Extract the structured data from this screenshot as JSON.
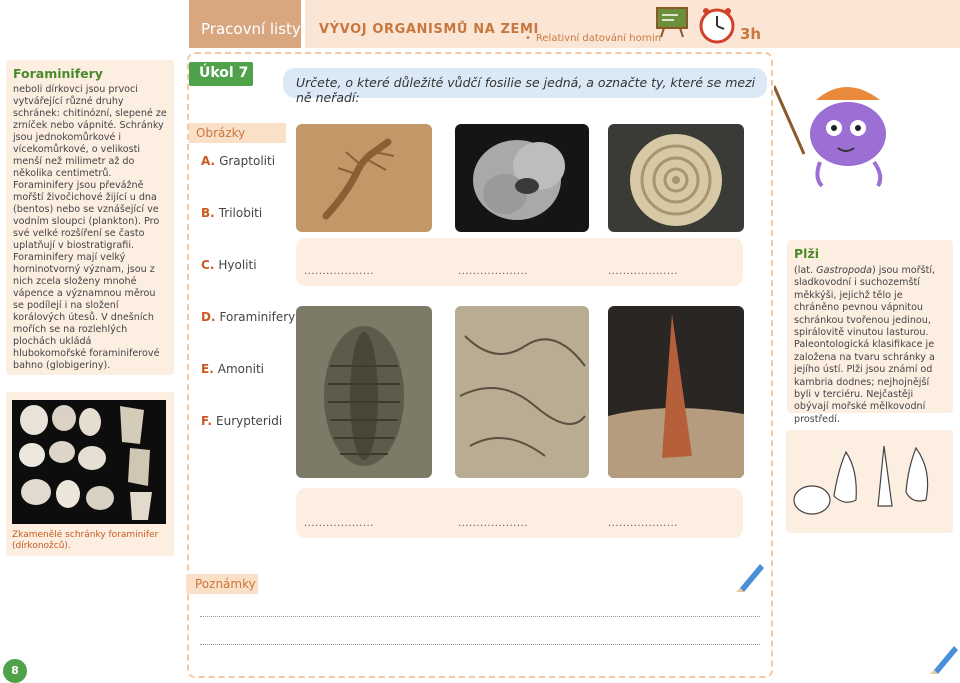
{
  "header": {
    "tab_label": "Pracovní listy",
    "title": "VÝVOJ ORGANISMŮ NA ZEMI",
    "subtitle": "Relativní datování hornin",
    "duration": "3h"
  },
  "sidebar": {
    "title": "Foraminifery",
    "text": "neboli dírkovci jsou prvoci vytvářející různé druhy schránek: chitinózní, slepené ze zrníček nebo vápnité. Schránky jsou jednokomůrkové i vícekomůrkové, o velikosti menší než milimetr až do několika centimetrů. Foraminifery jsou převážně mořští živočichové žijící u dna (bentos) nebo se vznášející ve vodním sloupci (plankton). Pro své velké rozšíření se často uplatňují v biostratigrafii. Foraminifery mají velký horninotvorný význam, jsou z nich zcela složeny mnohé vápence a významnou měrou se podílejí i na složení korálových útesů. V dnešních mořích se na rozlehlých plochách ukládá hlubokomořské foraminiferové bahno (globigeriny).",
    "photo_caption": "Zkamenělé schránky foraminifer (dírkonožců).",
    "page_number": "8"
  },
  "task": {
    "label": "Úkol 7",
    "instruction": "Určete, o které důležité vůdčí fosilie se jedná, a označte ty, které se mezi ně neřadí:",
    "images_label": "Obrázky",
    "options": [
      {
        "letter": "A.",
        "text": "Graptoliti"
      },
      {
        "letter": "B.",
        "text": "Trilobiti"
      },
      {
        "letter": "C.",
        "text": "Hyoliti"
      },
      {
        "letter": "D.",
        "text": "Foraminifery"
      },
      {
        "letter": "E.",
        "text": "Amoniti"
      },
      {
        "letter": "F.",
        "text": "Eurypteridi"
      }
    ],
    "answer_blank": "...................",
    "notes_label": "Poznámky"
  },
  "pzi": {
    "title": "Plži",
    "text_before": "(lat. ",
    "latin": "Gastropoda",
    "text_after": ") jsou mořští, sladkovodní i suchozemští měkkýši, jejichž tělo je chráněno pevnou vápnitou schránkou tvořenou jedinou, spirálovitě vinutou lasturou. Paleontologická klasifikace je založena na tvaru schránky a jejího ústí. Plži jsou známí od kambria dodnes; nejhojnější byli v terciéru. Nejčastěji obývají mořské mělkovodní prostředí."
  },
  "icons": [
    "chalkboard-icon",
    "clock-icon",
    "pencil-icon",
    "mascot-illustration",
    "shells-illustration"
  ]
}
